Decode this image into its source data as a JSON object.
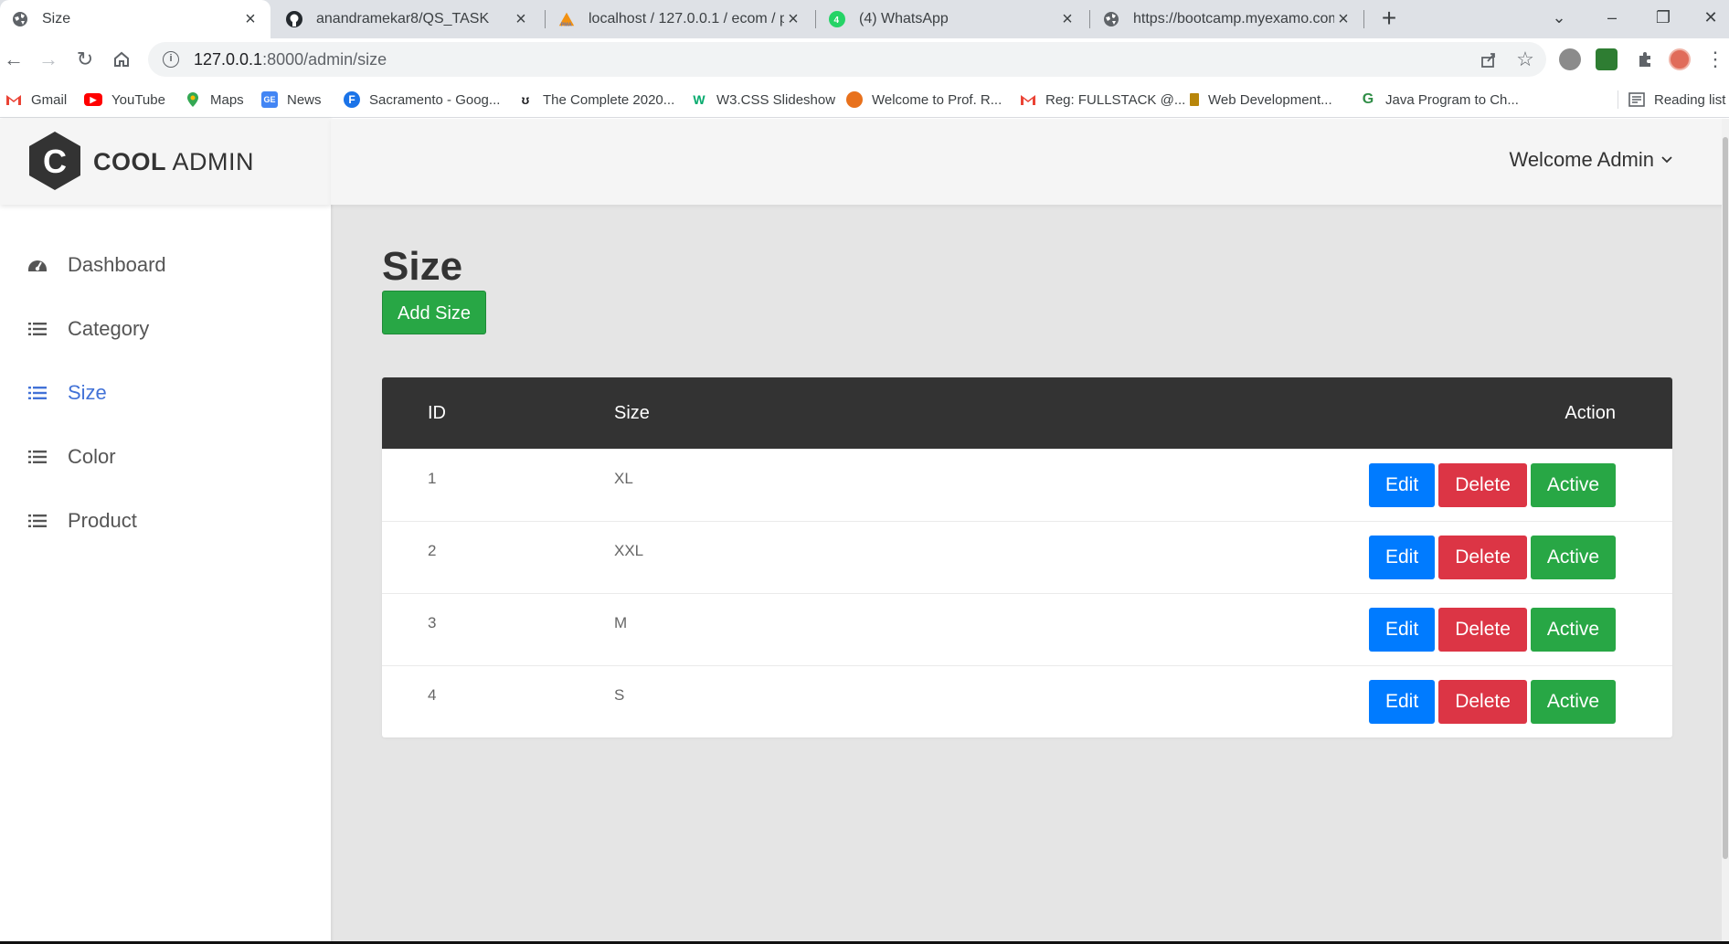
{
  "browser": {
    "tabs": [
      {
        "title": "Size",
        "active": true
      },
      {
        "title": "anandramekar8/QS_TASK",
        "active": false
      },
      {
        "title": "localhost / 127.0.0.1 / ecom / pro",
        "active": false
      },
      {
        "title": "(4) WhatsApp",
        "active": false
      },
      {
        "title": "https://bootcamp.myexamo.com",
        "active": false
      }
    ],
    "url_host": "127.0.0.1",
    "url_rest": ":8000/admin/size",
    "bookmarks": [
      {
        "label": "Gmail"
      },
      {
        "label": "YouTube"
      },
      {
        "label": "Maps"
      },
      {
        "label": "News"
      },
      {
        "label": "Sacramento - Goog..."
      },
      {
        "label": "The Complete 2020..."
      },
      {
        "label": "W3.CSS Slideshow"
      },
      {
        "label": "Welcome to Prof. R..."
      },
      {
        "label": "Reg: FULLSTACK @..."
      },
      {
        "label": "Web Development..."
      },
      {
        "label": "Java Program to Ch..."
      }
    ],
    "reading_list": "Reading list"
  },
  "app": {
    "logo_bold": "COOL",
    "logo_light": "ADMIN",
    "logo_letter": "C",
    "header": {
      "welcome": "Welcome Admin"
    },
    "sidebar": {
      "items": [
        {
          "label": "Dashboard",
          "icon": "dashboard-icon"
        },
        {
          "label": "Category",
          "icon": "list-icon"
        },
        {
          "label": "Size",
          "icon": "list-icon"
        },
        {
          "label": "Color",
          "icon": "list-icon"
        },
        {
          "label": "Product",
          "icon": "list-icon"
        }
      ],
      "active": "Size"
    },
    "page_title": "Size",
    "add_button": "Add Size",
    "table": {
      "columns": {
        "id": "ID",
        "size": "Size",
        "action": "Action"
      },
      "rows": [
        {
          "id": "1",
          "size": "XL"
        },
        {
          "id": "2",
          "size": "XXL"
        },
        {
          "id": "3",
          "size": "M"
        },
        {
          "id": "4",
          "size": "S"
        }
      ],
      "actions": {
        "edit": "Edit",
        "delete": "Delete",
        "active": "Active"
      }
    }
  },
  "colors": {
    "accent": "#4272d7",
    "success": "#28a745",
    "primary": "#007bff",
    "danger": "#dc3545",
    "table_header": "#333333"
  }
}
